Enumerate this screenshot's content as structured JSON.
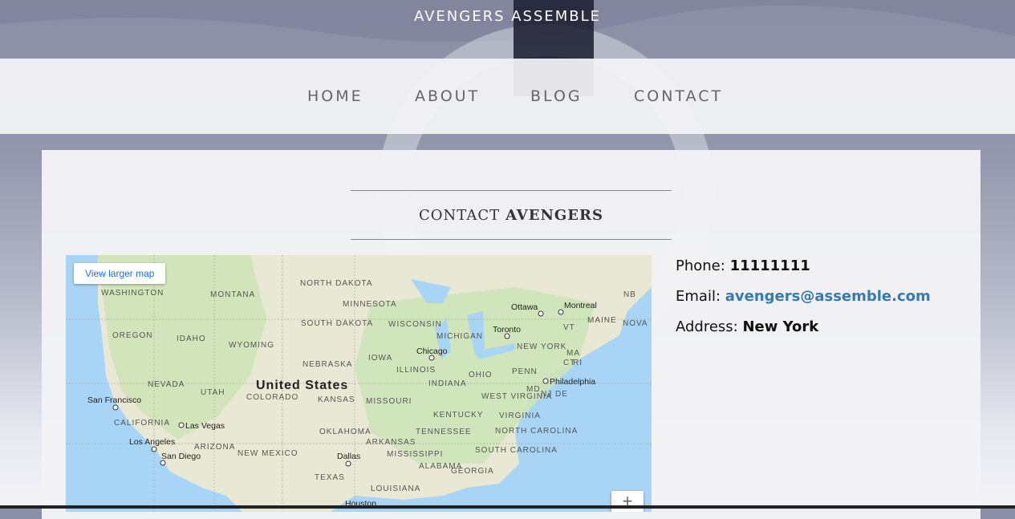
{
  "site": {
    "title": "AVENGERS ASSEMBLE"
  },
  "nav": {
    "items": [
      {
        "label": "HOME"
      },
      {
        "label": "ABOUT"
      },
      {
        "label": "BLOG"
      },
      {
        "label": "CONTACT"
      }
    ]
  },
  "contact": {
    "heading_light": "CONTACT",
    "heading_strong": "AVENGERS",
    "phone_label": "Phone:",
    "phone_value": "11111111",
    "email_label": "Email:",
    "email_value": "avengers@assemble.com",
    "address_label": "Address:",
    "address_value": "New York"
  },
  "map": {
    "larger_map_link": "View larger map",
    "zoom_in": "+",
    "country": "United States",
    "states": [
      "WASHINGTON",
      "MONTANA",
      "NORTH DAKOTA",
      "MINNESOTA",
      "OREGON",
      "IDAHO",
      "SOUTH DAKOTA",
      "WYOMING",
      "WISCONSIN",
      "MICHIGAN",
      "NEBRASKA",
      "IOWA",
      "ILLINOIS",
      "NEVADA",
      "UTAH",
      "COLORADO",
      "KANSAS",
      "MISSOURI",
      "INDIANA",
      "OHIO",
      "PENN",
      "NEW YORK",
      "CALIFORNIA",
      "ARIZONA",
      "NEW MEXICO",
      "OKLAHOMA",
      "ARKANSAS",
      "TENNESSEE",
      "KENTUCKY",
      "WEST VIRGINIA",
      "VIRGINIA",
      "NORTH CAROLINA",
      "SOUTH CAROLINA",
      "MISSISSIPPI",
      "ALABAMA",
      "GEORGIA",
      "TEXAS",
      "LOUISIANA",
      "MAINE",
      "VT",
      "NB",
      "NOVA",
      "MA",
      "CT",
      "RI",
      "NJ",
      "MD",
      "DE"
    ],
    "cities": [
      "Ottawa",
      "Montreal",
      "Toronto",
      "Chicago",
      "Philadelphia",
      "San Francisco",
      "Las Vegas",
      "Los Angeles",
      "San Diego",
      "Dallas",
      "Houston"
    ]
  }
}
